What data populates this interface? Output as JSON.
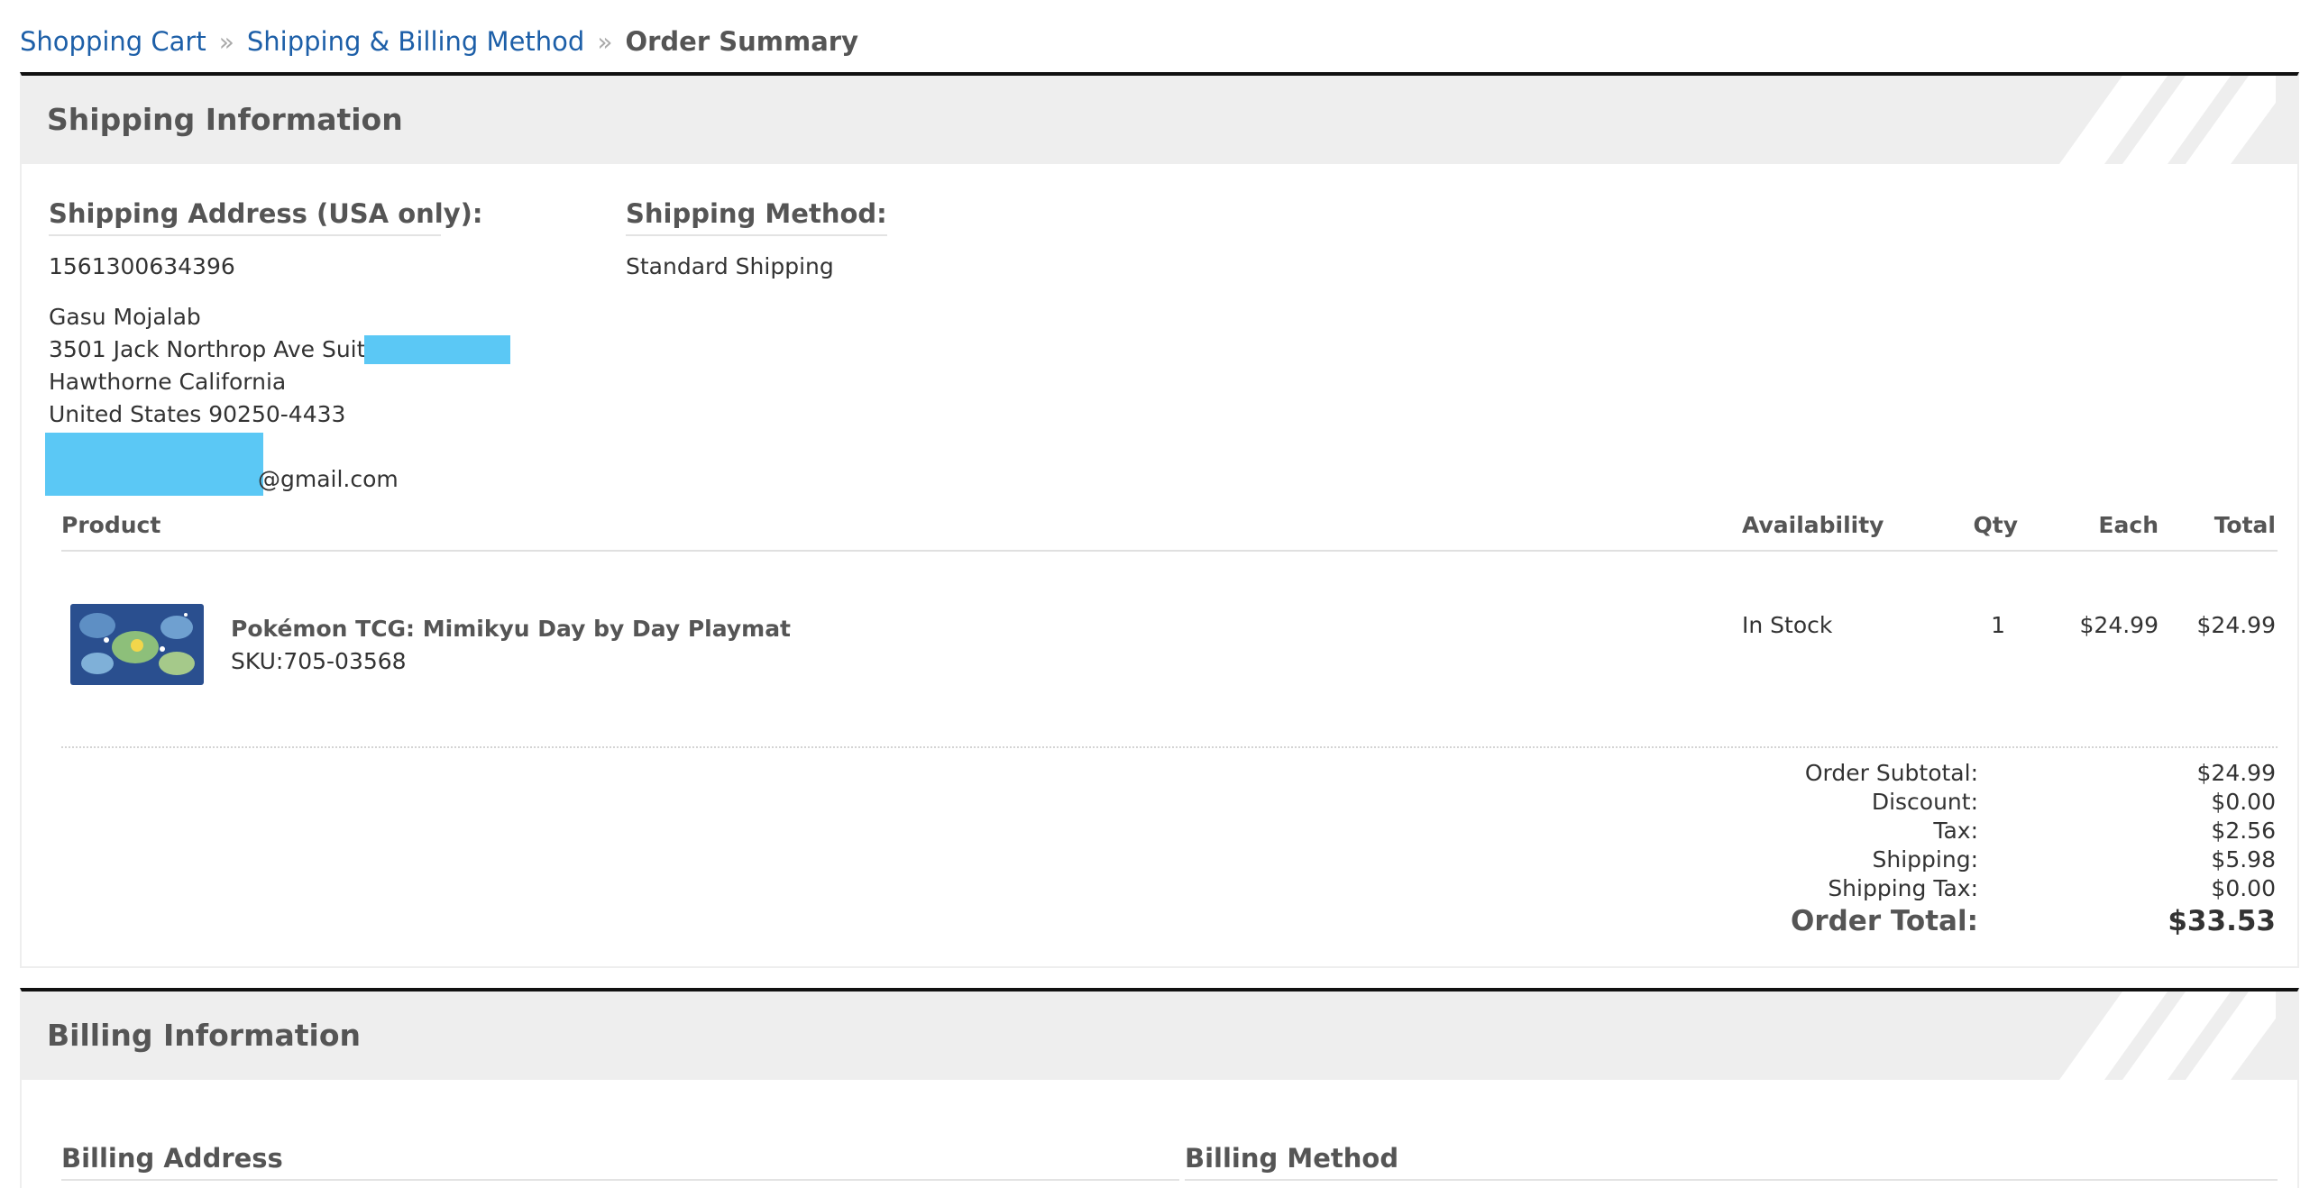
{
  "breadcrumb": {
    "step1": "Shopping Cart",
    "step2": "Shipping & Billing Method",
    "step3": "Order Summary",
    "separator": "»"
  },
  "shipping": {
    "title": "Shipping Information",
    "address_label": "Shipping Address (USA only):",
    "phone": "1561300634396",
    "name": "Gasu Mojalab",
    "street": "3501 Jack Northrop Ave Suite #",
    "city": "Hawthorne California",
    "country_zip": "United States 90250-4433",
    "email_suffix": "@gmail.com",
    "method_label": "Shipping Method:",
    "method": "Standard Shipping"
  },
  "table": {
    "headers": {
      "product": "Product",
      "availability": "Availability",
      "qty": "Qty",
      "each": "Each",
      "total": "Total"
    },
    "rows": [
      {
        "name": "Pokémon TCG: Mimikyu Day by Day Playmat",
        "sku": "SKU:705-03568",
        "availability": "In Stock",
        "qty": "1",
        "each": "$24.99",
        "total": "$24.99"
      }
    ]
  },
  "summary": {
    "subtotal_label": "Order Subtotal:",
    "subtotal": "$24.99",
    "discount_label": "Discount:",
    "discount": "$0.00",
    "tax_label": "Tax:",
    "tax": "$2.56",
    "shipping_label": "Shipping:",
    "shipping": "$5.98",
    "shipping_tax_label": "Shipping Tax:",
    "shipping_tax": "$0.00",
    "total_label": "Order Total:",
    "total": "$33.53"
  },
  "billing": {
    "title": "Billing Information",
    "address_label": "Billing Address",
    "method_label": "Billing Method"
  },
  "colors": {
    "link": "#1d5fa8",
    "redaction": "#5bc8f5",
    "header_bg": "#eeeeee"
  }
}
